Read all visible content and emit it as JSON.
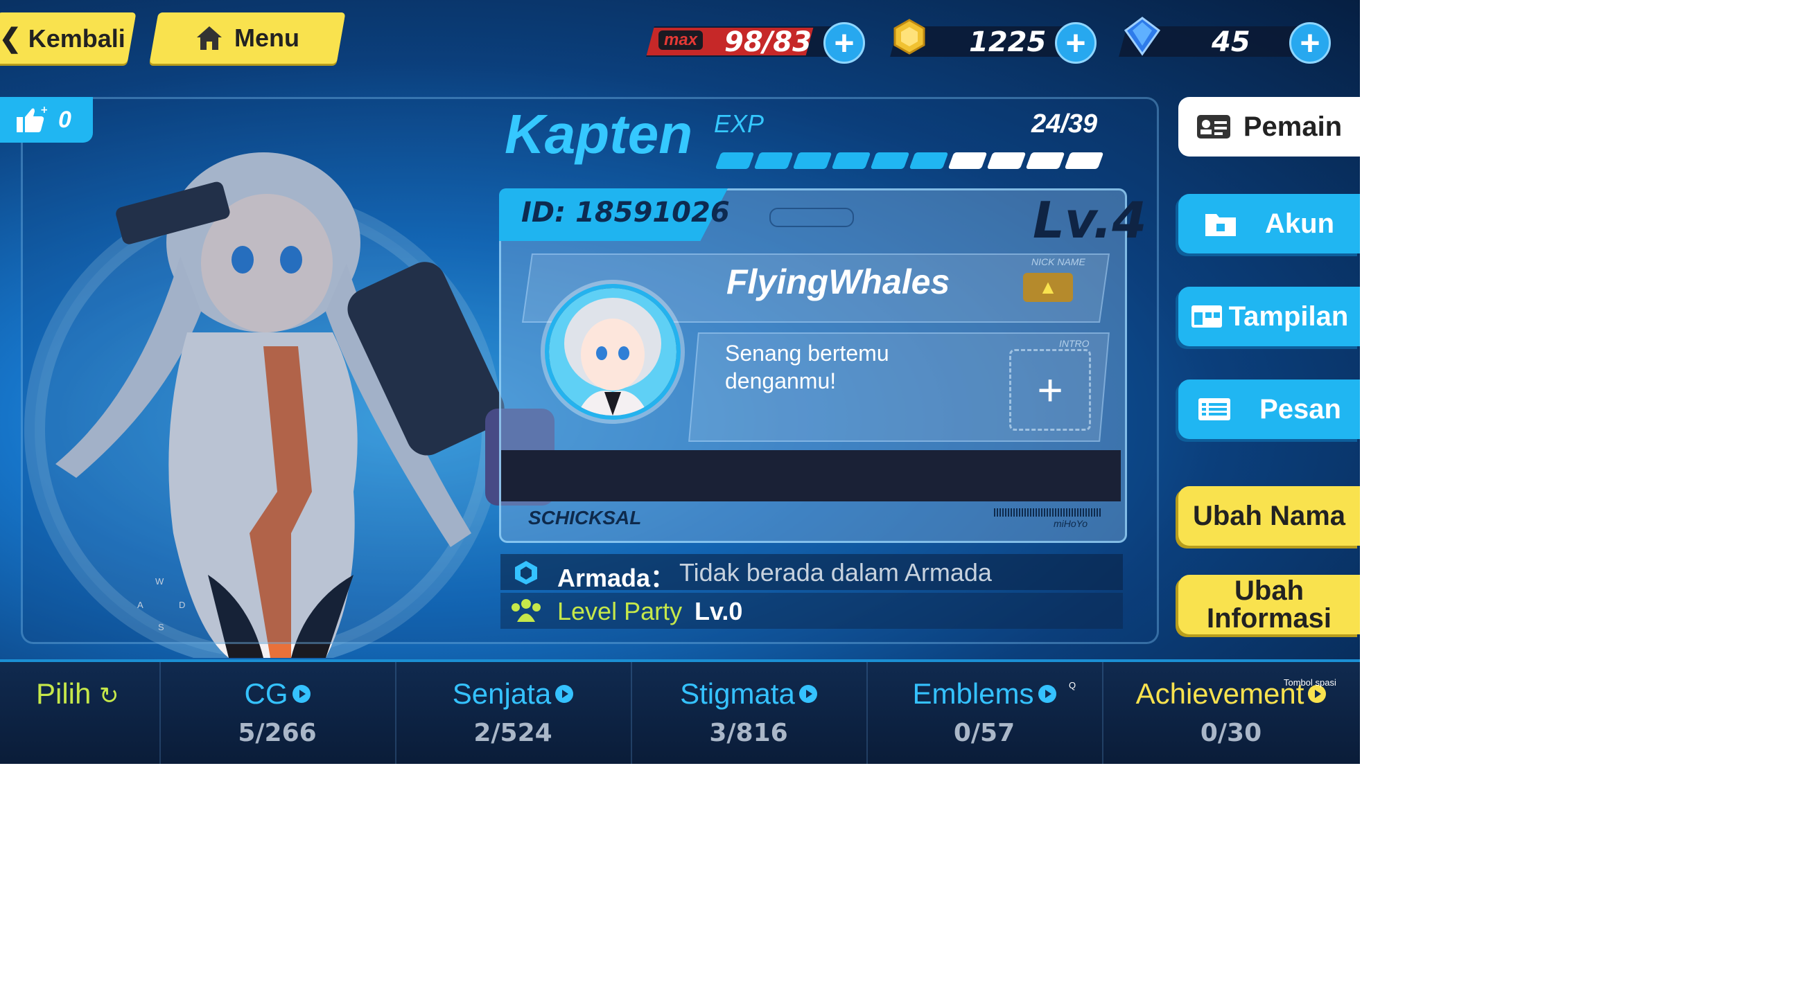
{
  "nav": {
    "back_label": "Kembali",
    "menu_label": "Menu"
  },
  "resources": {
    "stamina": {
      "badge": "max",
      "value": "98/83"
    },
    "coins": {
      "value": "1225"
    },
    "crystals": {
      "value": "45"
    }
  },
  "likes": {
    "count": "0"
  },
  "profile": {
    "title": "Kapten",
    "exp_label": "EXP",
    "exp_value": "24/39",
    "exp_fraction": 0.6,
    "id_label": "ID: 18591026",
    "level": "Lv.4",
    "nickname_caption": "NICK NAME",
    "nickname": "FlyingWhales",
    "intro_caption": "INTRO",
    "intro_text_line1": "Senang bertemu",
    "intro_text_line2": "denganmu!",
    "brand_left": "SCHICKSAL",
    "brand_right": "miHoYo"
  },
  "armada": {
    "label": "Armada：",
    "value": "Tidak berada dalam Armada"
  },
  "party": {
    "label": "Level Party",
    "value": "Lv.0"
  },
  "side_menu": {
    "player": "Pemain",
    "account": "Akun",
    "display": "Tampilan",
    "message": "Pesan",
    "rename": "Ubah Nama",
    "edit_info_line1": "Ubah",
    "edit_info_line2": "Informasi"
  },
  "bottom_tabs": [
    {
      "label": "Pilih",
      "count": ""
    },
    {
      "label": "CG",
      "count": "5/266"
    },
    {
      "label": "Senjata",
      "count": "2/524"
    },
    {
      "label": "Stigmata",
      "count": "3/816"
    },
    {
      "label": "Emblems",
      "count": "0/57"
    },
    {
      "label": "Achievement",
      "count": "0/30"
    }
  ],
  "key_hints": {
    "w": "W",
    "a": "A",
    "s": "S",
    "d": "D",
    "q": "Q",
    "space": "Tombol spasi"
  },
  "colors": {
    "accent": "#20b6f2",
    "yellow": "#f9e24e",
    "green": "#c6e84a"
  }
}
